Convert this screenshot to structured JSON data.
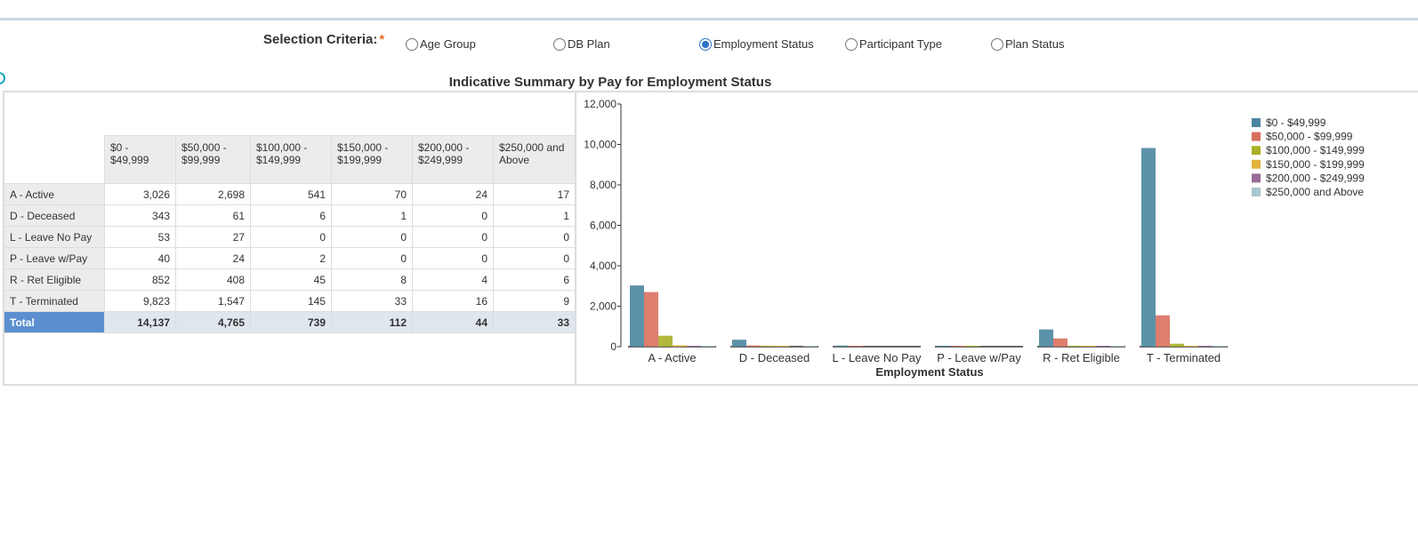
{
  "criteria": {
    "label": "Selection Criteria:",
    "required_mark": "*",
    "options": [
      {
        "label": "Age Group",
        "checked": false
      },
      {
        "label": "DB Plan",
        "checked": false
      },
      {
        "label": "Employment Status",
        "checked": true
      },
      {
        "label": "Participant Type",
        "checked": false
      },
      {
        "label": "Plan Status",
        "checked": false
      }
    ]
  },
  "title": "Indicative Summary by Pay for Employment Status",
  "table": {
    "columns": [
      "$0 - $49,999",
      "$50,000 - $99,999",
      "$100,000 - $149,999",
      "$150,000 - $199,999",
      "$200,000 - $249,999",
      "$250,000 and Above"
    ],
    "rows": [
      {
        "label": "A - Active",
        "values": [
          "3,026",
          "2,698",
          "541",
          "70",
          "24",
          "17"
        ]
      },
      {
        "label": "D - Deceased",
        "values": [
          "343",
          "61",
          "6",
          "1",
          "0",
          "1"
        ]
      },
      {
        "label": "L - Leave No Pay",
        "values": [
          "53",
          "27",
          "0",
          "0",
          "0",
          "0"
        ]
      },
      {
        "label": "P - Leave w/Pay",
        "values": [
          "40",
          "24",
          "2",
          "0",
          "0",
          "0"
        ]
      },
      {
        "label": "R - Ret Eligible",
        "values": [
          "852",
          "408",
          "45",
          "8",
          "4",
          "6"
        ]
      },
      {
        "label": "T - Terminated",
        "values": [
          "9,823",
          "1,547",
          "145",
          "33",
          "16",
          "9"
        ]
      }
    ],
    "total": {
      "label": "Total",
      "values": [
        "14,137",
        "4,765",
        "739",
        "112",
        "44",
        "33"
      ]
    }
  },
  "chart_data": {
    "type": "bar",
    "categories": [
      "A - Active",
      "D - Deceased",
      "L - Leave No Pay",
      "P - Leave w/Pay",
      "R - Ret Eligible",
      "T - Terminated"
    ],
    "series": [
      {
        "name": "$0 - $49,999",
        "color": "#4a86a0",
        "values": [
          3026,
          343,
          53,
          40,
          852,
          9823
        ]
      },
      {
        "name": "$50,000 - $99,999",
        "color": "#d9705e",
        "values": [
          2698,
          61,
          27,
          24,
          408,
          1547
        ]
      },
      {
        "name": "$100,000 - $149,999",
        "color": "#aab027",
        "values": [
          541,
          6,
          0,
          2,
          45,
          145
        ]
      },
      {
        "name": "$150,000 - $199,999",
        "color": "#e3b23c",
        "values": [
          70,
          1,
          0,
          0,
          8,
          33
        ]
      },
      {
        "name": "$200,000 - $249,999",
        "color": "#9a6a9a",
        "values": [
          24,
          0,
          0,
          0,
          4,
          16
        ]
      },
      {
        "name": "$250,000 and Above",
        "color": "#a9c7cf",
        "values": [
          17,
          1,
          0,
          0,
          6,
          9
        ]
      }
    ],
    "xlabel": "Employment Status",
    "ylabel": "",
    "ylim": [
      0,
      12000
    ],
    "yticks": [
      "0",
      "2,000",
      "4,000",
      "6,000",
      "8,000",
      "10,000",
      "12,000"
    ],
    "legend": "top-right",
    "grid": false
  }
}
